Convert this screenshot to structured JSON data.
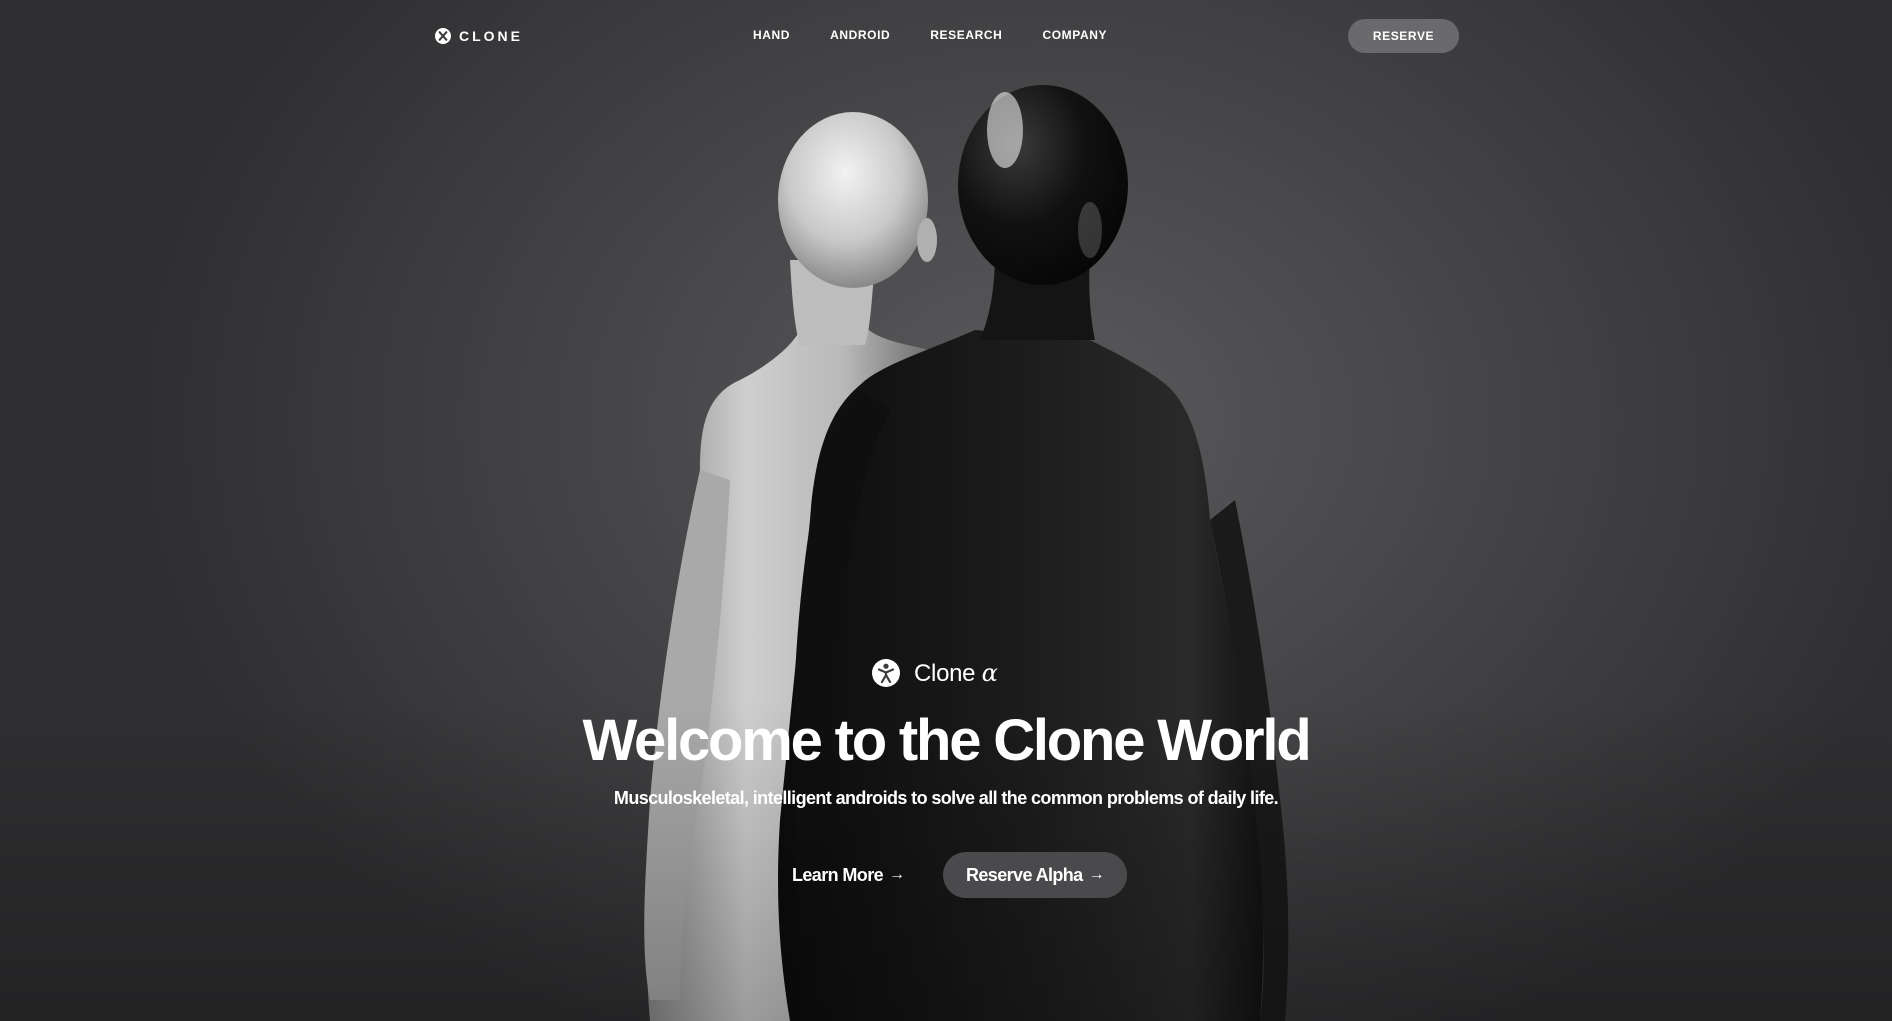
{
  "nav": {
    "logo_text": "CLONE",
    "logo_icon": "clone-x-logo-icon",
    "links": [
      {
        "label": "HAND"
      },
      {
        "label": "ANDROID"
      },
      {
        "label": "RESEARCH"
      },
      {
        "label": "COMPANY"
      }
    ],
    "reserve_label": "RESERVE"
  },
  "hero": {
    "product_name": "Clone",
    "product_suffix": "α",
    "product_icon": "clone-figure-logo-icon",
    "headline": "Welcome to the Clone World",
    "subhead": "Musculoskeletal, intelligent androids to solve all the common problems of daily life.",
    "learn_more_label": "Learn More",
    "reserve_alpha_label": "Reserve Alpha",
    "arrow_glyph": "→"
  },
  "colors": {
    "background": "#3b3b3d",
    "text": "#ffffff",
    "reserve_button": "#6a6a6d",
    "cta_button": "#4a4a4c"
  }
}
